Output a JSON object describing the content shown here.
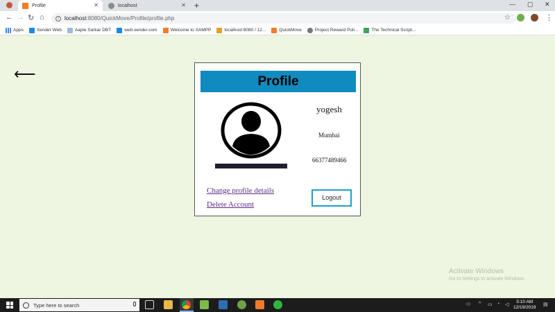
{
  "browser": {
    "tabs": [
      {
        "title": "Profile",
        "active": true
      },
      {
        "title": "localhost",
        "active": false
      }
    ],
    "new_tab": "+",
    "url_host": "localhost",
    "url_path": ":8080/QuickMove/Profile/profile.php",
    "bookmarks": [
      {
        "label": "Apps",
        "icon": "apps-grid-icon"
      },
      {
        "label": "Xender Web",
        "icon": "xender-icon"
      },
      {
        "label": "Aaple Sarkar DBT",
        "icon": "page-icon"
      },
      {
        "label": "web.xender.com",
        "icon": "xender-icon"
      },
      {
        "label": "Welcome to XAMPP",
        "icon": "xampp-icon"
      },
      {
        "label": "localhost:8080 / 12...",
        "icon": "phpmyadmin-icon"
      },
      {
        "label": "QuickMove",
        "icon": "xampp-icon"
      },
      {
        "label": "Project Reward Poli...",
        "icon": "globe-icon"
      },
      {
        "label": "The Technical Script...",
        "icon": "tech-icon"
      }
    ]
  },
  "page": {
    "back_arrow": "⟵",
    "card": {
      "title": "Profile",
      "name": "yogesh",
      "city": "Mumbai",
      "phone": "66377489466",
      "change_link": "Change profile details",
      "delete_link": "Delete Account",
      "logout_label": "Logout"
    },
    "watermark": {
      "line1": "Activate Windows",
      "line2": "Go to Settings to activate Windows."
    }
  },
  "taskbar": {
    "search_placeholder": "Type here to search",
    "time": "5:10 AM",
    "date": "12/19/2019"
  },
  "colors": {
    "page_bg": "#eef5e0",
    "title_bar": "#0f8bbf",
    "logout_border": "#1ba0c8",
    "link": "#5b2a86"
  }
}
